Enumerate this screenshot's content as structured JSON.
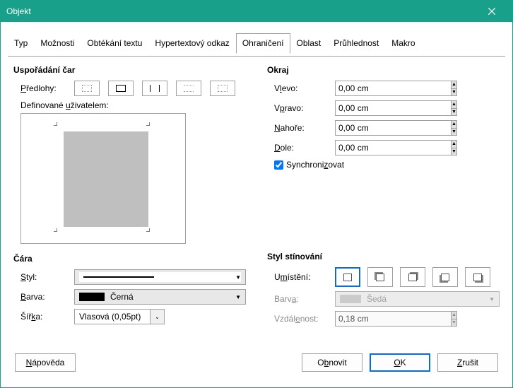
{
  "title": "Objekt",
  "tabs": {
    "typ": "Typ",
    "moznosti": "Možnosti",
    "obtekani": "Obtékání textu",
    "hyper": "Hypertextový odkaz",
    "ohraniceni": "Ohraničení",
    "oblast": "Oblast",
    "pruhlednost": "Průhlednost",
    "makro": "Makro"
  },
  "linearr": {
    "title": "Uspořádání čar",
    "presets_label": "Předlohy:",
    "userdef": "Definované uživatelem:"
  },
  "line": {
    "title": "Čára",
    "style_label": "Styl:",
    "color_label": "Barva:",
    "color_value": "Černá",
    "width_label": "Šířka:",
    "width_value": "Vlasová (0,05pt)"
  },
  "margin": {
    "title": "Okraj",
    "left_label": "Vlevo:",
    "right_label": "Vpravo:",
    "top_label": "Nahoře:",
    "bottom_label": "Dole:",
    "left": "0,00 cm",
    "right": "0,00 cm",
    "top": "0,00 cm",
    "bottom": "0,00 cm",
    "sync": "Synchronizovat"
  },
  "shadow": {
    "title": "Styl stínování",
    "pos_label": "Umístění:",
    "color_label": "Barva:",
    "color_value": "Šedá",
    "dist_label": "Vzdálenost:",
    "dist_value": "0,18 cm"
  },
  "footer": {
    "help": "Nápověda",
    "refresh": "Obnovit",
    "ok": "OK",
    "cancel": "Zrušit"
  }
}
